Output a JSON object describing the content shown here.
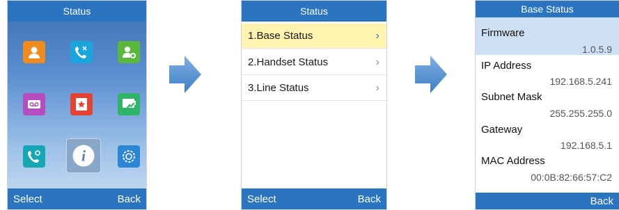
{
  "screen1": {
    "title": "Status",
    "softkey_left": "Select",
    "softkey_right": "Back",
    "icons": [
      "contacts-icon",
      "call-history-icon",
      "settings-user-icon",
      "voicemail-icon",
      "favorites-icon",
      "forward-icon",
      "call-settings-icon",
      "status-info-icon",
      "system-settings-icon"
    ]
  },
  "screen2": {
    "title": "Status",
    "items": [
      {
        "label": "1.Base Status",
        "selected": true
      },
      {
        "label": "2.Handset Status",
        "selected": false
      },
      {
        "label": "3.Line Status",
        "selected": false
      }
    ],
    "softkey_left": "Select",
    "softkey_right": "Back"
  },
  "screen3": {
    "title": "Base Status",
    "fields": [
      {
        "label": "Firmware",
        "value": "1.0.5.9"
      },
      {
        "label": "IP Address",
        "value": "192.168.5.241"
      },
      {
        "label": "Subnet Mask",
        "value": "255.255.255.0"
      },
      {
        "label": "Gateway",
        "value": "192.168.5.1"
      },
      {
        "label": "MAC Address",
        "value": "00:0B:82:66:57:C2"
      }
    ],
    "softkey_right": "Back"
  },
  "colors": {
    "accent": "#2a74c0",
    "selected": "#fff3b0",
    "highlight": "#cde0f5"
  }
}
